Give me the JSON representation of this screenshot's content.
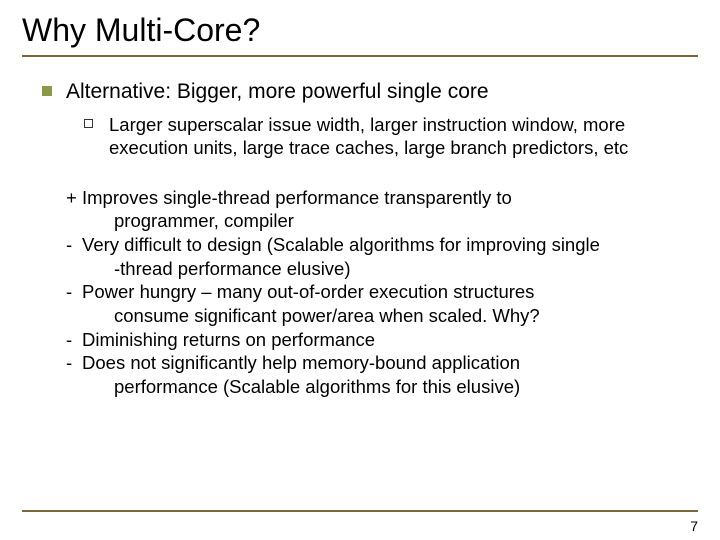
{
  "title": "Why Multi-Core?",
  "level1": "Alternative: Bigger, more powerful single core",
  "level2": "Larger superscalar issue width, larger instruction window, more execution units, large trace caches, large branch predictors, etc",
  "points": {
    "p1_sign": "+",
    "p1_line1": "Improves single-thread performance transparently to",
    "p1_line2": "programmer, compiler",
    "p2_sign": "-",
    "p2_line1": "Very difficult to design (Scalable algorithms for improving single",
    "p2_line2": "-thread performance elusive)",
    "p3_sign": "-",
    "p3_line1": "Power hungry – many out-of-order execution structures",
    "p3_line2": "consume significant power/area when scaled. Why?",
    "p4_sign": "-",
    "p4_line1": "Diminishing returns on performance",
    "p5_sign": "-",
    "p5_line1": "Does not significantly help memory-bound application",
    "p5_line2": "performance (Scalable algorithms for this elusive)"
  },
  "page_number": "7"
}
